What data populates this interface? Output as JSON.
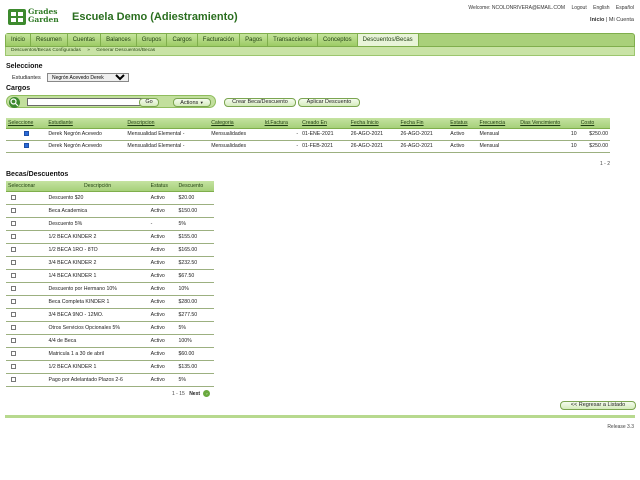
{
  "header": {
    "logo_line1": "Grades",
    "logo_line2": "Garden",
    "title": "Escuela Demo (Adiestramiento)",
    "welcome": "Welcome: NCOLONRIVERA@EMAIL.COM",
    "logout": "Logout",
    "english": "English",
    "spanish": "Español",
    "inicio": "Inicio",
    "mi_cuenta": "Mi Cuenta"
  },
  "nav": [
    "Inicio",
    "Resumen",
    "Cuentas",
    "Balances",
    "Grupos",
    "Cargos",
    "Facturación",
    "Pagos",
    "Transacciones",
    "Conceptos",
    "Descuentos/Becas"
  ],
  "subnav": [
    "Descuentos/Becas Configuradas",
    "»",
    "Generar Descuentos/Becas"
  ],
  "seleccione": {
    "title": "Seleccione",
    "estudiante_label": "Estudiantes",
    "estudiante_value": "Negrón Acevedo Derek"
  },
  "cargos": {
    "title": "Cargos",
    "go": "Go",
    "actions": "Actions",
    "crear": "Crear Beca/Descuento",
    "aplicar": "Aplicar Descuento",
    "columns": [
      "Seleccione",
      "Estudiante",
      "Descripcion",
      "Categoria",
      "Id.Factura",
      "Creado En",
      "Fecha Inicio",
      "Fecha Fin",
      "Estatus",
      "Frecuencia",
      "Dias Vencimiento",
      "Costo"
    ],
    "rows": [
      [
        "",
        "Derek Negrón Acevedo",
        "Mensualidad Elemental -",
        "Mensualidades",
        "-",
        "01-ENE-2021",
        "26-AGO-2021",
        "26-AGO-2021",
        "Activo",
        "Mensual",
        "10",
        "$250.00"
      ],
      [
        "",
        "Derek Negrón Acevedo",
        "Mensualidad Elemental -",
        "Mensualidades",
        "-",
        "01-FEB-2021",
        "26-AGO-2021",
        "26-AGO-2021",
        "Activo",
        "Mensual",
        "10",
        "$250.00"
      ]
    ],
    "pager": "1 - 2"
  },
  "becas": {
    "title": "Becas/Descuentos",
    "columns": [
      "Seleccionar",
      "Descripción",
      "Estatus",
      "Descuento"
    ],
    "rows": [
      [
        "Descuento $20",
        "Activo",
        "$20.00"
      ],
      [
        "Beca Academica",
        "Activo",
        "$150.00"
      ],
      [
        "Descuento 5%",
        "-",
        "5%"
      ],
      [
        "1/2 BECA KINDER 2",
        "Activo",
        "$155.00"
      ],
      [
        "1/2 BECA 1RO - 8TO",
        "Activo",
        "$165.00"
      ],
      [
        "3/4 BECA KINDER 2",
        "Activo",
        "$232.50"
      ],
      [
        "1/4 BECA KINDER 1",
        "Activo",
        "$67.50"
      ],
      [
        "Descuento por Hermano 10%",
        "Activo",
        "10%"
      ],
      [
        "Beca Completa KINDER 1",
        "Activo",
        "$280.00"
      ],
      [
        "3/4 BECA 9NO - 12MO.",
        "Activo",
        "$277.50"
      ],
      [
        "Otros Servicios Opcionales 5%",
        "Activo",
        "5%"
      ],
      [
        "4/4 de Beca",
        "Activo",
        "100%"
      ],
      [
        "Matricula 1 a 30 de abril",
        "Activo",
        "$60.00"
      ],
      [
        "1/2 BECA KINDER 1",
        "Activo",
        "$135.00"
      ],
      [
        "Pago por Adelantado Plazos 2-6",
        "Activo",
        "5%"
      ]
    ],
    "pager": "1 - 15",
    "next": "Next"
  },
  "back": "<< Regresar a Listado",
  "release": "Release 3.3",
  "colors": {
    "brand": "#2a6e1f",
    "nav": "#a9d07a",
    "header_row": "#b3d78a"
  }
}
